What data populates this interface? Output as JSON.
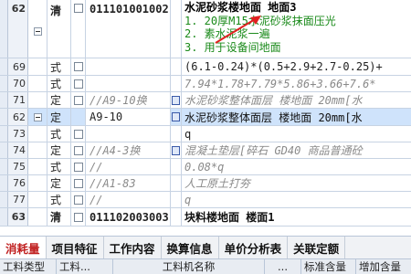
{
  "rows": [
    {
      "num": "62",
      "type": "清",
      "code": "011101001002",
      "name_lines": [
        "水泥砂浆楼地面  地面3",
        "1. 20厚M15水泥砂浆抹面压光",
        "2. 素水泥浆一遍",
        "3. 用于设备间地面"
      ]
    },
    {
      "num": "69",
      "type": "式",
      "code": "",
      "name": "(6.1-0.24)*(0.5+2.9+2.7-0.25)+"
    },
    {
      "num": "70",
      "type": "式",
      "code": "",
      "name": "7.94*1.78+7.79*5.86+3.66+7.6*"
    },
    {
      "num": "71",
      "type": "定",
      "code": "//A9-10换",
      "name": "水泥砂浆整体面层 楼地面 20mm[水"
    },
    {
      "num": "62",
      "type": "定",
      "code": "A9-10",
      "name": "水泥砂浆整体面层 楼地面 20mm[水"
    },
    {
      "num": "73",
      "type": "式",
      "code": "",
      "name": "q"
    },
    {
      "num": "74",
      "type": "定",
      "code": "//A4-3换",
      "name": "混凝土垫层[碎石 GD40 商品普通砼"
    },
    {
      "num": "75",
      "type": "式",
      "code": "//",
      "name": "0.08*q"
    },
    {
      "num": "76",
      "type": "定",
      "code": "//A1-83",
      "name": "人工原土打夯"
    },
    {
      "num": "77",
      "type": "式",
      "code": "//",
      "name": "q"
    },
    {
      "num": "63",
      "type": "清",
      "code": "011102003003",
      "name": "块料楼地面 楼面1"
    }
  ],
  "tabs": [
    "消耗量",
    "项目特征",
    "工作内容",
    "换算信息",
    "单价分析表",
    "关联定额"
  ],
  "columns": [
    "工料类型",
    "工料...",
    "工料机名称",
    "...",
    "标准含量",
    "增加含量"
  ],
  "colors": {
    "green": "#1a8a1a",
    "red_arrow": "#e02020",
    "selected": "#cfe3fb"
  }
}
